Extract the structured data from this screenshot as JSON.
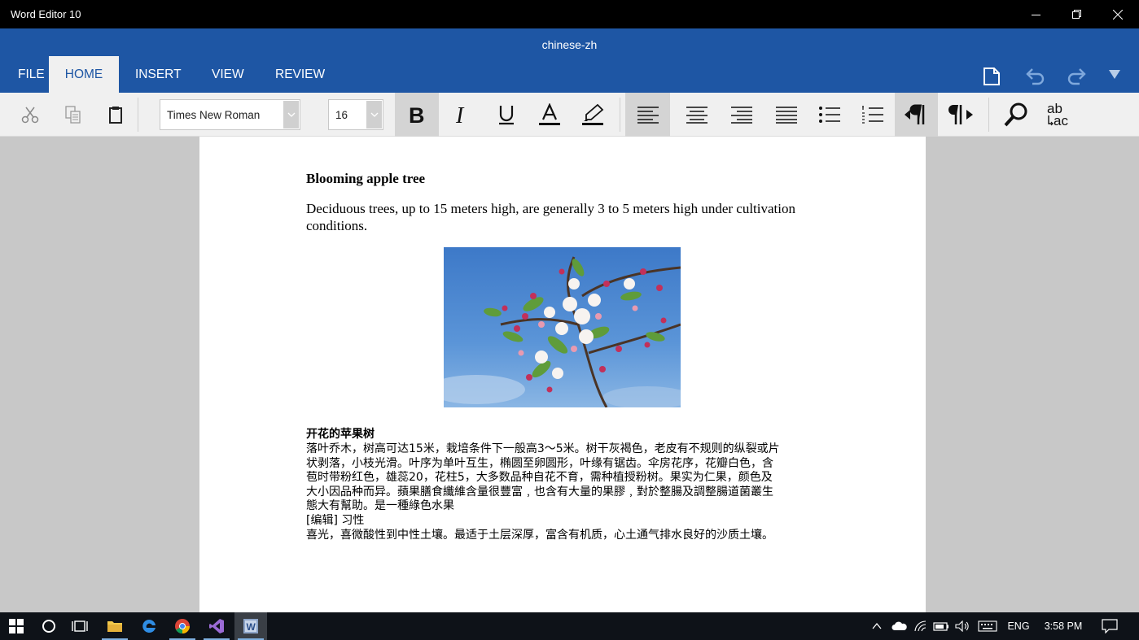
{
  "window": {
    "app_title": "Word Editor 10",
    "document_name": "chinese-zh"
  },
  "ribbon": {
    "tabs": [
      {
        "label": "FILE",
        "active": false
      },
      {
        "label": "HOME",
        "active": true
      },
      {
        "label": "INSERT",
        "active": false
      },
      {
        "label": "VIEW",
        "active": false
      },
      {
        "label": "REVIEW",
        "active": false
      }
    ],
    "header_icons": [
      "new-document-icon",
      "undo-icon",
      "redo-icon",
      "collapse-ribbon-icon"
    ]
  },
  "toolbar": {
    "font_family": "Times New Roman",
    "font_size": "16",
    "find_replace_text": {
      "line1": "ab",
      "line2": "ac"
    },
    "active_states": {
      "bold": true,
      "align_left": true,
      "ltr": true
    }
  },
  "document": {
    "heading_en": "Blooming apple tree",
    "paragraph_en": "Deciduous trees, up to 15 meters high, are generally 3 to 5 meters high under cultivation conditions.",
    "image_description": "apple-blossom-photo",
    "heading_zh": "开花的苹果树",
    "lines_zh": [
      "落叶乔木，树高可达15米，栽培条件下一般高3～5米。树干灰褐色，老皮有不规则的纵裂或片",
      "状剥落，小枝光滑。叶序为单叶互生，椭圆至卵圆形，叶缘有锯齿。伞房花序，花瓣白色，含",
      "苞时带粉红色，雄蕊20，花柱5，大多数品种自花不育，需种植授粉树。果实为仁果，颜色及",
      "大小因品种而异。蘋果膳食纖維含量很豐富﹐也含有大量的果膠﹐對於整腸及調整腸道菌叢生",
      "態大有幫助。是一種綠色水果",
      "[编辑] 习性",
      "喜光，喜微酸性到中性土壤。最适于土层深厚，富含有机质，心土通气排水良好的沙质土壤。"
    ]
  },
  "taskbar": {
    "language": "ENG",
    "time": "3:58 PM"
  },
  "colors": {
    "ribbon_blue": "#1e56a4",
    "toolbar_bg": "#f0f0f0",
    "canvas_gray": "#c8c8c8",
    "taskbar_bg": "#0e1218"
  }
}
